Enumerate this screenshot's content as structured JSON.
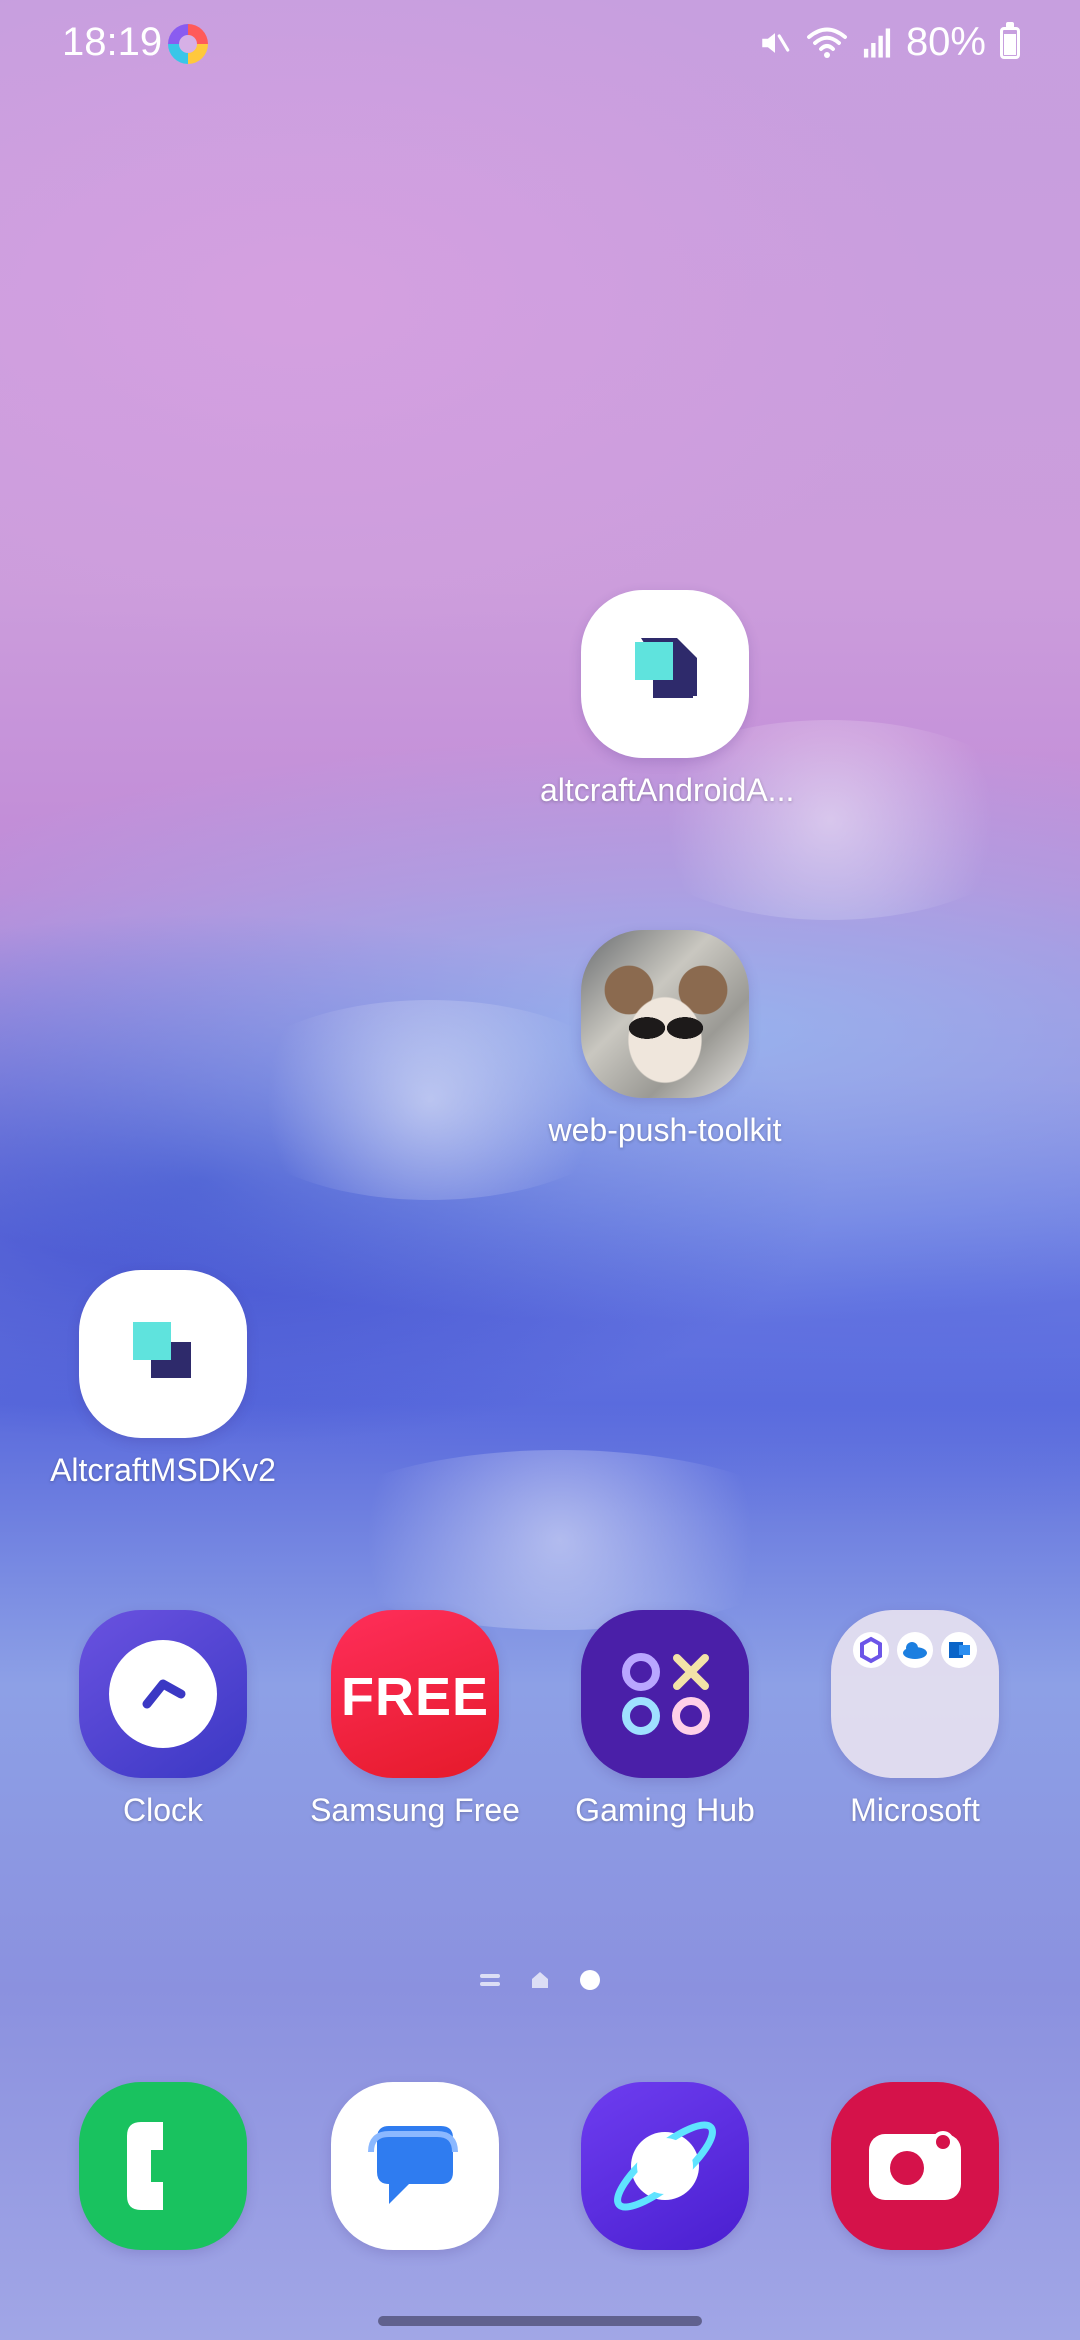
{
  "status_bar": {
    "time": "18:19",
    "battery": "80%",
    "icons": [
      "assistant-app-icon",
      "mute-icon",
      "wifi-icon",
      "signal-icon",
      "battery-icon"
    ]
  },
  "home_apps": [
    {
      "label": "altcraftAndroidA...",
      "icon": "altcraft-icon"
    },
    {
      "label": "web-push-toolkit",
      "icon": "cat-photo-icon"
    },
    {
      "label": "AltcraftMSDKv2",
      "icon": "altcraft-icon"
    }
  ],
  "row_apps": [
    {
      "label": "Clock",
      "icon": "clock-icon"
    },
    {
      "label": "Samsung Free",
      "icon": "samsung-free-icon",
      "text": "FREE"
    },
    {
      "label": "Gaming Hub",
      "icon": "gaming-hub-icon"
    },
    {
      "label": "Microsoft",
      "icon": "folder-icon"
    }
  ],
  "dock": [
    {
      "icon": "phone-icon"
    },
    {
      "icon": "messages-icon"
    },
    {
      "icon": "internet-icon"
    },
    {
      "icon": "camera-icon"
    }
  ],
  "page_indicator": {
    "pages": 3,
    "current": 3
  },
  "colors": {
    "accent_teal": "#5fe3dd",
    "accent_navy": "#2e2a6b"
  }
}
